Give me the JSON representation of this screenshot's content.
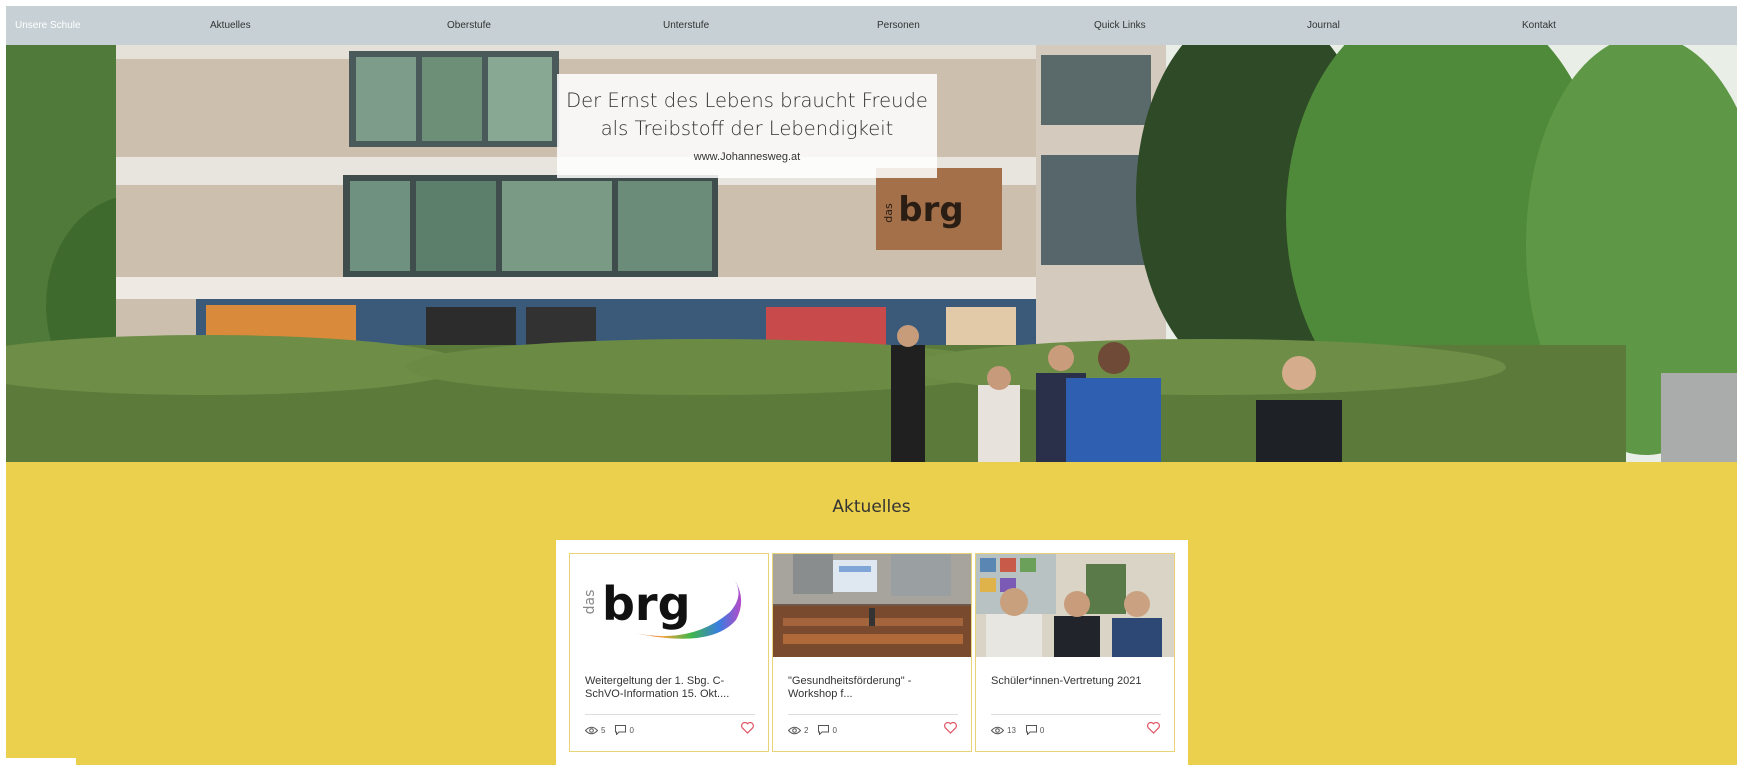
{
  "nav": {
    "items": [
      {
        "label": "Unsere Schule"
      },
      {
        "label": "Aktuelles"
      },
      {
        "label": "Oberstufe"
      },
      {
        "label": "Unterstufe"
      },
      {
        "label": "Personen"
      },
      {
        "label": "Quick Links"
      },
      {
        "label": "Journal"
      },
      {
        "label": "Kontakt"
      }
    ]
  },
  "hero": {
    "title_line1": "Der Ernst des Lebens braucht Freude",
    "title_line2": "als Treibstoff der Lebendigkeit",
    "url": "www.Johannesweg.at",
    "sign_text": "brg",
    "sign_prefix": "das"
  },
  "news": {
    "heading": "Aktuelles",
    "posts": [
      {
        "title": "Weitergeltung der 1. Sbg. C-SchVO-Information 15. Okt....",
        "views": "5",
        "comments": "0",
        "logo_text": "brg",
        "logo_prefix": "das"
      },
      {
        "title": "\"Gesundheitsförderung\" - Workshop f...",
        "views": "2",
        "comments": "0"
      },
      {
        "title": "Schüler*innen-Vertretung 2021",
        "views": "13",
        "comments": "0"
      }
    ]
  },
  "colors": {
    "nav_bg": "#c6d0d5",
    "section_bg": "#ead04c",
    "heart": "#e05363"
  },
  "icons": [
    "eye-icon",
    "comment-icon",
    "heart-icon"
  ]
}
